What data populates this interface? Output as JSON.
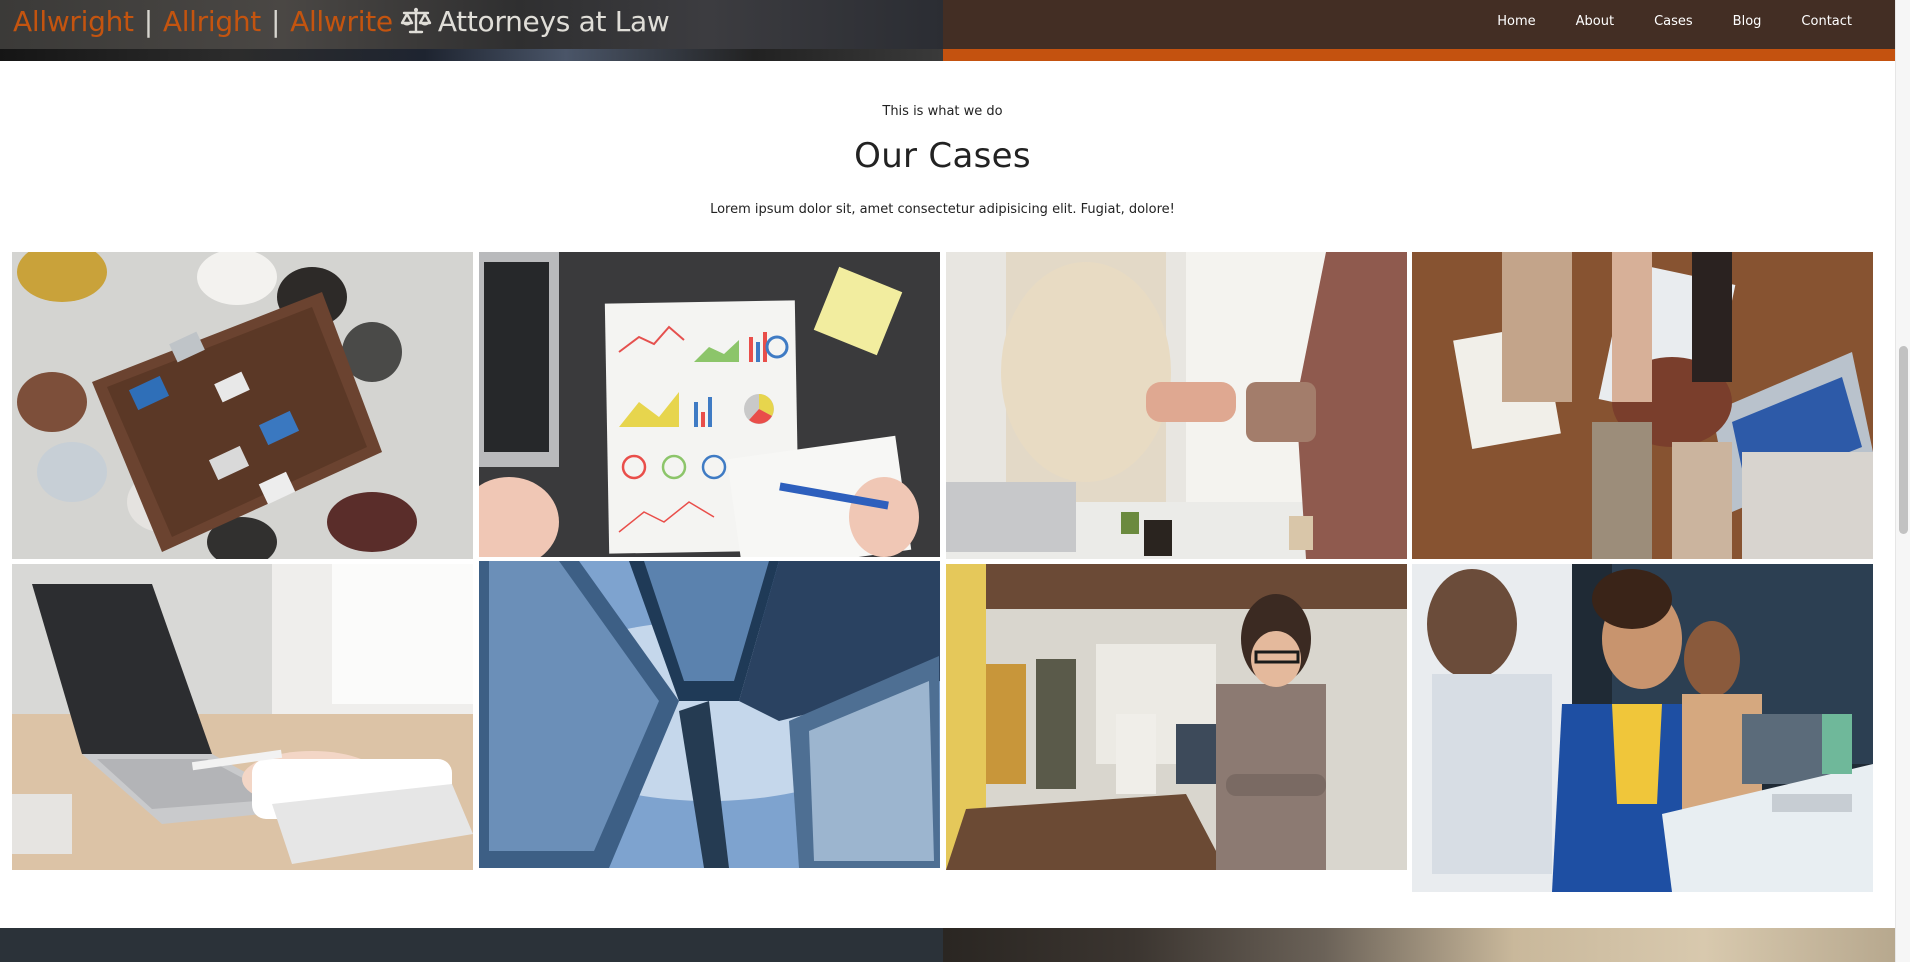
{
  "header": {
    "brand": {
      "firm_1": "Allwright",
      "firm_2": "Allright",
      "firm_3": "Allwrite",
      "separator": "|",
      "tagline": "Attorneys at Law",
      "icon": "scale-icon"
    },
    "nav": [
      {
        "label": "Home"
      },
      {
        "label": "About"
      },
      {
        "label": "Cases"
      },
      {
        "label": "Blog"
      },
      {
        "label": "Contact"
      }
    ]
  },
  "cases": {
    "kicker": "This is what we do",
    "title": "Our Cases",
    "intro": "Lorem ipsum dolor sit, amet consectetur adipisicing elit. Fugiat, dolore!"
  },
  "colors": {
    "accent": "#c4520f",
    "header_right": "#432e24",
    "footer_left": "#2b3239",
    "text": "#222222"
  }
}
